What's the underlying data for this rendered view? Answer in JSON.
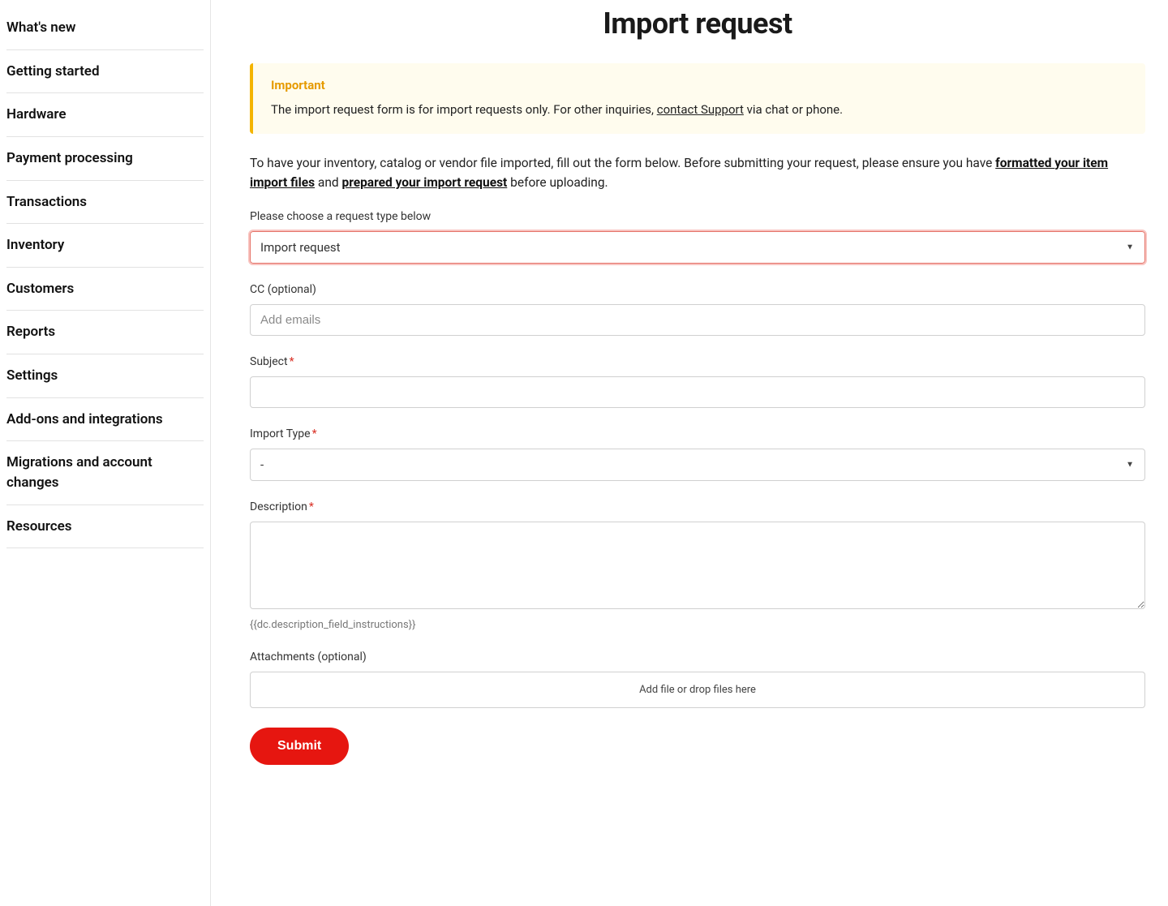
{
  "sidebar": {
    "items": [
      "What's new",
      "Getting started",
      "Hardware",
      "Payment processing",
      "Transactions",
      "Inventory",
      "Customers",
      "Reports",
      "Settings",
      "Add-ons and integrations",
      "Migrations and account changes",
      "Resources"
    ]
  },
  "page": {
    "title": "Import request"
  },
  "callout": {
    "title": "Important",
    "body_pre": "The import request form is for import requests only. For other inquiries, ",
    "body_link": "contact Support",
    "body_post": " via chat or phone."
  },
  "intro": {
    "part1": "To have your inventory, catalog or vendor file imported, fill out the form below. Before submitting your request, please ensure you have ",
    "link1": "formatted your item import files",
    "sep": " and ",
    "link2": "prepared your import request",
    "part2": " before uploading."
  },
  "form": {
    "request_type_label": "Please choose a request type below",
    "request_type_value": "Import request",
    "cc_label": "CC (optional)",
    "cc_placeholder": "Add emails",
    "subject_label": "Subject",
    "import_type_label": "Import Type",
    "import_type_value": "-",
    "description_label": "Description",
    "description_hint": "{{dc.description_field_instructions}}",
    "attachments_label": "Attachments (optional)",
    "attachments_drop": "Add file or drop files here",
    "submit_label": "Submit"
  }
}
